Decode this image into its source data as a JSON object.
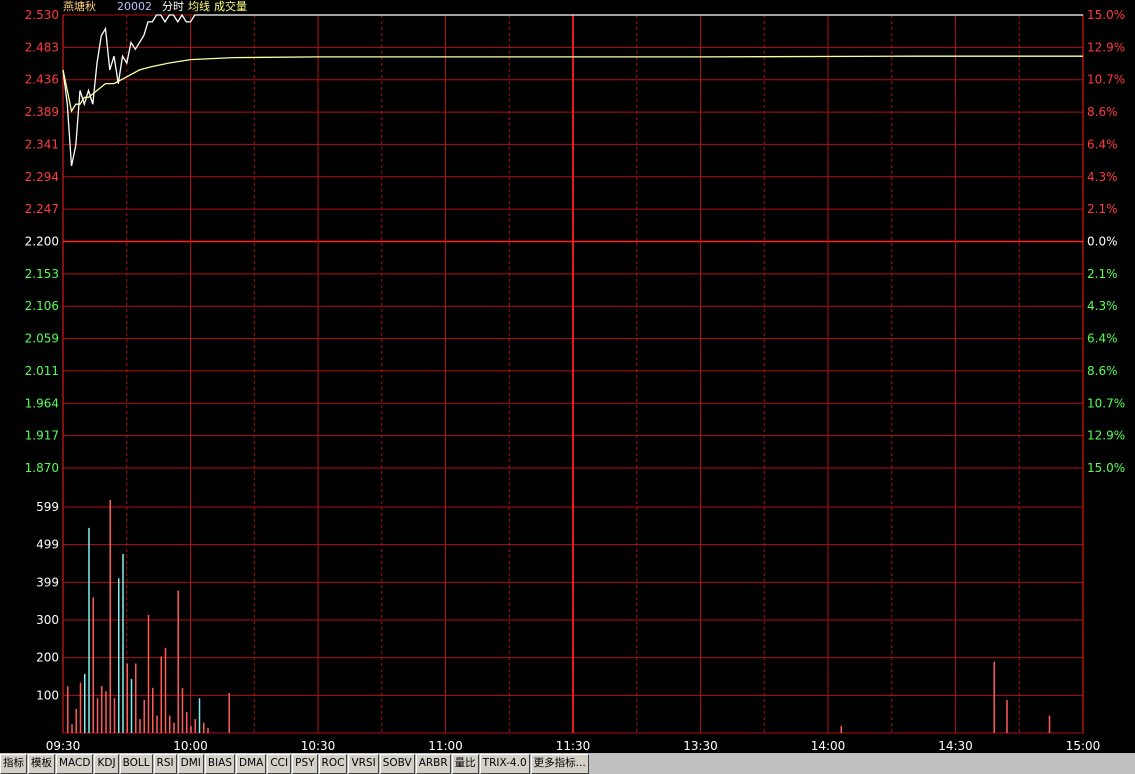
{
  "header": {
    "stock_name": "燕塘秋",
    "stock_code": "20002",
    "legend_items": [
      "分时",
      "均线",
      "成交量"
    ]
  },
  "colors": {
    "background": "#000000",
    "grid": "#b01010",
    "grid_major": "#ff2020",
    "up": "#ff3b3b",
    "down": "#55ff55",
    "neutral": "#ffffff",
    "price_line": "#ffffff",
    "avg_line": "#ffffa0",
    "vol_up": "#ff5a5a",
    "vol_down": "#7ff0f0"
  },
  "tabs": [
    "指标",
    "模板",
    "MACD",
    "KDJ",
    "BOLL",
    "RSI",
    "DMI",
    "BIAS",
    "DMA",
    "CCI",
    "PSY",
    "ROC",
    "VRSI",
    "SOBV",
    "ARBR",
    "量比",
    "TRIX-4.0",
    "更多指标..."
  ],
  "chart_data": [
    {
      "type": "line",
      "title": "",
      "y_left_ticks": [
        "2.530",
        "2.483",
        "2.436",
        "2.389",
        "2.341",
        "2.294",
        "2.247",
        "2.200",
        "2.153",
        "2.106",
        "2.059",
        "2.011",
        "1.964",
        "1.917",
        "1.870"
      ],
      "y_right_ticks": [
        "15.0%",
        "12.9%",
        "10.7%",
        "8.6%",
        "6.4%",
        "4.3%",
        "2.1%",
        "0.0%",
        "2.1%",
        "4.3%",
        "6.4%",
        "8.6%",
        "10.7%",
        "12.9%",
        "15.0%"
      ],
      "ylim": [
        1.87,
        2.53
      ],
      "prev_close": 2.2,
      "x_ticks": [
        "09:30",
        "10:00",
        "10:30",
        "11:00",
        "11:30",
        "13:30",
        "14:00",
        "14:30",
        "15:00"
      ],
      "x_minutes_range": [
        0,
        240
      ],
      "series": [
        {
          "name": "分时",
          "x_minutes": [
            0,
            1,
            2,
            3,
            4,
            5,
            6,
            7,
            8,
            9,
            10,
            11,
            12,
            13,
            14,
            15,
            16,
            17,
            18,
            19,
            20,
            21,
            22,
            23,
            24,
            25,
            26,
            27,
            28,
            29,
            30,
            31,
            32,
            33,
            34,
            240
          ],
          "values": [
            2.45,
            2.4,
            2.31,
            2.34,
            2.42,
            2.4,
            2.42,
            2.4,
            2.46,
            2.5,
            2.51,
            2.45,
            2.47,
            2.43,
            2.47,
            2.46,
            2.49,
            2.48,
            2.49,
            2.5,
            2.52,
            2.52,
            2.53,
            2.53,
            2.52,
            2.53,
            2.53,
            2.52,
            2.53,
            2.52,
            2.52,
            2.53,
            2.53,
            2.53,
            2.53,
            2.53
          ]
        },
        {
          "name": "均线",
          "x_minutes": [
            0,
            1,
            2,
            3,
            4,
            5,
            6,
            8,
            10,
            12,
            15,
            18,
            21,
            25,
            30,
            40,
            60,
            100,
            150,
            200,
            240
          ],
          "values": [
            2.45,
            2.42,
            2.39,
            2.4,
            2.4,
            2.41,
            2.41,
            2.42,
            2.43,
            2.43,
            2.44,
            2.45,
            2.455,
            2.46,
            2.465,
            2.468,
            2.469,
            2.469,
            2.469,
            2.47,
            2.47
          ]
        }
      ]
    },
    {
      "type": "bar",
      "title": "",
      "y_ticks": [
        "599",
        "499",
        "399",
        "300",
        "200",
        "100"
      ],
      "ylim": [
        0,
        650
      ],
      "x_minutes": [
        1,
        2,
        3,
        4,
        5,
        6,
        7,
        8,
        9,
        10,
        11,
        12,
        13,
        14,
        15,
        16,
        17,
        18,
        19,
        20,
        21,
        22,
        23,
        24,
        25,
        26,
        27,
        28,
        29,
        30,
        31,
        32,
        33,
        34,
        39,
        183,
        219,
        222,
        232
      ],
      "values": [
        135,
        25,
        70,
        145,
        170,
        590,
        390,
        100,
        135,
        120,
        670,
        100,
        445,
        515,
        200,
        155,
        200,
        40,
        95,
        340,
        130,
        50,
        220,
        245,
        50,
        30,
        410,
        130,
        60,
        20,
        40,
        100,
        30,
        15,
        115,
        20,
        205,
        95,
        50
      ],
      "directions": [
        "up",
        "up",
        "up",
        "up",
        "down",
        "down",
        "up",
        "up",
        "up",
        "up",
        "up",
        "up",
        "down",
        "down",
        "up",
        "down",
        "up",
        "up",
        "up",
        "up",
        "up",
        "up",
        "up",
        "up",
        "up",
        "up",
        "up",
        "up",
        "up",
        "up",
        "up",
        "down",
        "up",
        "up",
        "up",
        "up",
        "up",
        "up",
        "up"
      ]
    }
  ]
}
